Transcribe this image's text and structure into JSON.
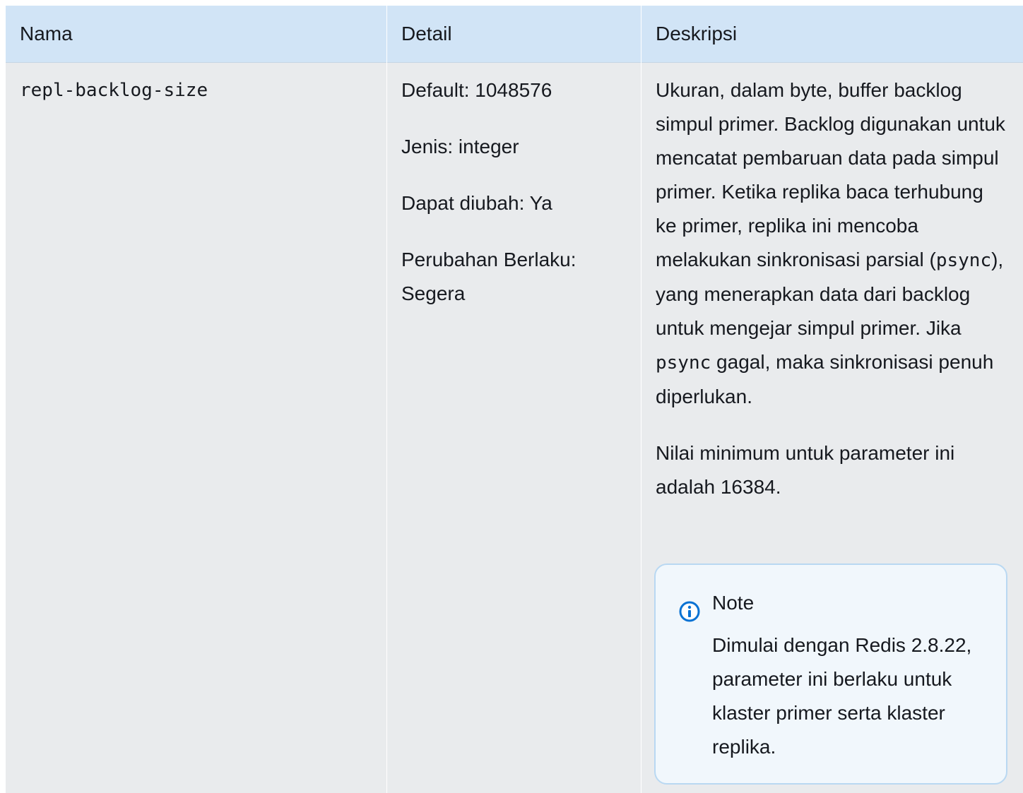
{
  "table": {
    "headers": [
      "Nama",
      "Detail",
      "Deskripsi"
    ],
    "row": {
      "name": "repl-backlog-size",
      "details": [
        "Default: 1048576",
        "Jenis: integer",
        "Dapat diubah: Ya",
        "Perubahan Berlaku:",
        "Segera"
      ],
      "description": {
        "p1_part1": "Ukuran, dalam byte, buffer backlog simpul primer. Backlog digunakan untuk mencatat pembaruan data pada simpul primer. Ketika replika baca terhubung ke primer, replika ini mencoba melakukan sinkronisasi parsial (",
        "p1_code1": "psync",
        "p1_part2": "), yang menerapkan data dari backlog untuk mengejar simpul primer. Jika ",
        "p1_code2": "psync",
        "p1_part3": " gagal, maka sinkronisasi penuh diperlukan.",
        "p2": "Nilai minimum untuk parameter ini adalah 16384."
      },
      "note": {
        "icon": "info-icon",
        "title": "Note",
        "body": "Dimulai dengan Redis 2.8.22, parameter ini berlaku untuk klaster primer serta klaster replika."
      }
    }
  },
  "colors": {
    "header_bg": "#d1e4f6",
    "cell_bg": "#e9ebed",
    "note_border": "#b9d8f2",
    "note_bg": "#f1f7fc",
    "info_icon": "#0972d3"
  }
}
